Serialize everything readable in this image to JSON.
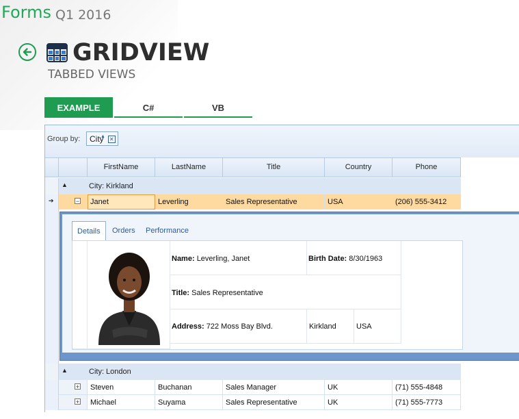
{
  "app": {
    "brand": "Forms",
    "version": "Q1 2016"
  },
  "page": {
    "title": "GRIDVIEW",
    "subtitle": "TABBED VIEWS"
  },
  "tabs": [
    {
      "label": "EXAMPLE",
      "active": true
    },
    {
      "label": "C#",
      "active": false
    },
    {
      "label": "VB",
      "active": false
    }
  ],
  "grid": {
    "group_by_label": "Group by:",
    "group_chip": "City",
    "columns": [
      "FirstName",
      "LastName",
      "Title",
      "Country",
      "Phone"
    ],
    "groups": [
      {
        "header": "City: Kirkland",
        "rows": [
          {
            "first": "Janet",
            "last": "Leverling",
            "title": "Sales Representative",
            "country": "USA",
            "phone": "(206) 555-3412"
          }
        ]
      },
      {
        "header": "City: London",
        "rows": [
          {
            "first": "Steven",
            "last": "Buchanan",
            "title": "Sales Manager",
            "country": "UK",
            "phone": "(71) 555-4848"
          },
          {
            "first": "Michael",
            "last": "Suyama",
            "title": "Sales Representative",
            "country": "UK",
            "phone": "(71) 555-7773"
          }
        ]
      }
    ],
    "detail": {
      "tabs": [
        "Details",
        "Orders",
        "Performance"
      ],
      "name_label": "Name:",
      "name_value": "Leverling, Janet",
      "birth_label": "Birth Date:",
      "birth_value": "8/30/1963",
      "title_label": "Title:",
      "title_value": "Sales Representative",
      "address_label": "Address:",
      "address_value": "722 Moss Bay Blvd.",
      "city": "Kirkland",
      "country": "USA"
    }
  },
  "colors": {
    "accent": "#1f9b52",
    "selected_row": "#fed9a0",
    "grid_border": "#9dbad9"
  }
}
